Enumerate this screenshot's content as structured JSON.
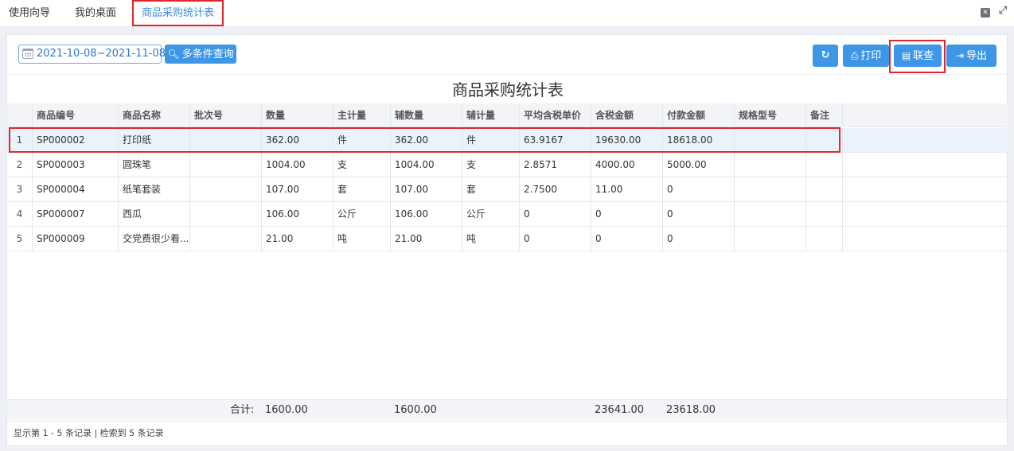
{
  "tabs": [
    "使用向导",
    "我的桌面",
    "商品采购统计表"
  ],
  "window_controls": {
    "close": "✕",
    "fullscreen": "⤢"
  },
  "toolbar": {
    "date_range": "2021-10-08~2021-11-08",
    "query_label": "多条件查询",
    "refresh_icon": "↻",
    "print_label": "打印",
    "lianCha_label": "联查",
    "export_label": "导出"
  },
  "report_title": "商品采购统计表",
  "table": {
    "columns": [
      "商品编号",
      "商品名称",
      "批次号",
      "数量",
      "主计量",
      "辅数量",
      "辅计量",
      "平均含税单价",
      "含税金额",
      "付款金额",
      "规格型号",
      "备注"
    ],
    "rows": [
      [
        "1",
        "SP000002",
        "打印纸",
        "",
        "362.00",
        "件",
        "362.00",
        "件",
        "63.9167",
        "19630.00",
        "18618.00",
        "",
        ""
      ],
      [
        "2",
        "SP000003",
        "圆珠笔",
        "",
        "1004.00",
        "支",
        "1004.00",
        "支",
        "2.8571",
        "4000.00",
        "5000.00",
        "",
        ""
      ],
      [
        "3",
        "SP000004",
        "纸笔套装",
        "",
        "107.00",
        "套",
        "107.00",
        "套",
        "2.7500",
        "11.00",
        "0",
        "",
        ""
      ],
      [
        "4",
        "SP000007",
        "西瓜",
        "",
        "106.00",
        "公斤",
        "106.00",
        "公斤",
        "0",
        "0",
        "0",
        "",
        ""
      ],
      [
        "5",
        "SP000009",
        "交党费很少看...",
        "",
        "21.00",
        "吨",
        "21.00",
        "吨",
        "0",
        "0",
        "0",
        "",
        ""
      ]
    ]
  },
  "summary": {
    "label": "合计:",
    "qty": "1600.00",
    "aux_qty": "1600.00",
    "tax_amount": "23641.00",
    "paid_amount": "23618.00"
  },
  "pager_text": "显示第 1 - 5 条记录 | 检索到 5 条记录",
  "colors": {
    "accent": "#3d97e6",
    "highlight": "#e0262c"
  }
}
